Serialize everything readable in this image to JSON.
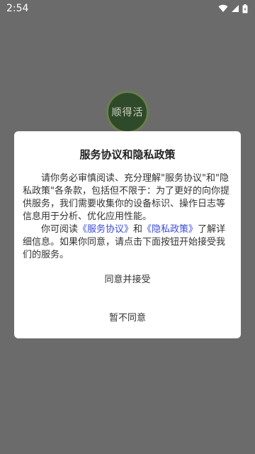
{
  "status_bar": {
    "time": "2:54"
  },
  "app_logo": {
    "text": "顺得活"
  },
  "dialog": {
    "title": "服务协议和隐私政策",
    "paragraph1": "请你务必审慎阅读、充分理解\"服务协议\"和\"隐私政策\"各条款，包括但不限于：为了更好的向你提供服务，我们需要收集你的设备标识、操作日志等信息用于分析、优化应用性能。",
    "paragraph2_prefix": "你可阅读",
    "link_service": "《服务协议》",
    "paragraph2_and": "和",
    "link_privacy": "《隐私政策》",
    "paragraph2_suffix": "了解详细信息。如果你同意，请点击下面按钮开始接受我们的服务。",
    "agree_button": "同意并接受",
    "disagree_button": "暂不同意"
  },
  "colors": {
    "link": "#3a4bd6",
    "scrim": "#6b6b6b"
  },
  "icons": [
    "wifi-icon",
    "cellular-signal-icon",
    "battery-icon"
  ]
}
